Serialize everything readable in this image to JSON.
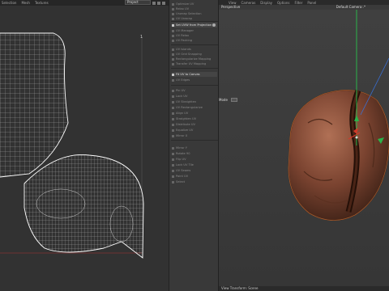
{
  "uv_editor": {
    "menu": [
      "Selection",
      "Mesh",
      "Textures"
    ],
    "project_select": "Project",
    "corner_marker": "1"
  },
  "commands": [
    {
      "label": "Optimize UV",
      "active": false
    },
    {
      "label": "Relax UV",
      "active": false
    },
    {
      "label": "Unwrap Selection",
      "active": false
    },
    {
      "label": "UV Unwrap",
      "active": false
    },
    {
      "label": "Set UVW from Projection",
      "active": true
    },
    {
      "label": "UV Manager",
      "active": false
    },
    {
      "label": "UV Relax",
      "active": false
    },
    {
      "label": "UV Packing",
      "active": false
    },
    {
      "label": "UV Islands",
      "active": false
    },
    {
      "label": "UV Grid Snapping",
      "active": false
    },
    {
      "label": "Rectangularize Mapping",
      "active": false
    },
    {
      "label": "Transfer UV Mapping",
      "active": false
    },
    {
      "label": "Fit UV to Canvas",
      "active": true
    },
    {
      "label": "UV Edges",
      "active": false
    },
    {
      "label": "Pin UV",
      "active": false
    },
    {
      "label": "Lock UV",
      "active": false
    },
    {
      "label": "UV Straighten",
      "active": false
    },
    {
      "label": "UV Rectangularize",
      "active": false
    },
    {
      "label": "Align UV",
      "active": false
    },
    {
      "label": "Straighten UV",
      "active": false
    },
    {
      "label": "Distribute UV",
      "active": false
    },
    {
      "label": "Equalize UV",
      "active": false
    },
    {
      "label": "Mirror X",
      "active": false
    },
    {
      "label": "Mirror Y",
      "active": false
    },
    {
      "label": "Rotate 90",
      "active": false
    },
    {
      "label": "Flip UV",
      "active": false
    },
    {
      "label": "Lock UV Tile",
      "active": false
    },
    {
      "label": "UV Seams",
      "active": false
    },
    {
      "label": "Paint UV",
      "active": false
    },
    {
      "label": "Select",
      "active": false
    }
  ],
  "viewport": {
    "menu": [
      "View",
      "Cameras",
      "Display",
      "Options",
      "Filter",
      "Panel"
    ],
    "perspective_label": "Perspective",
    "camera_label": "Default Camera:.*",
    "side_label": "Mode",
    "footer": "View Transform: Scene"
  },
  "colors": {
    "bean_dark": "#3a1f14",
    "bean_mid": "#6e3b26",
    "bean_light": "#a5674a",
    "axis_green": "#2bb34a",
    "axis_red": "#d23a2a",
    "axis_blue": "#3a6fd2"
  }
}
